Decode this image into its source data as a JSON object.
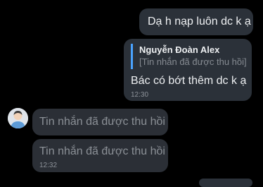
{
  "messages": {
    "outgoing_1": {
      "text": "Dạ h nạp luôn dc k ạ"
    },
    "outgoing_2": {
      "reply_name": "Nguyễn Đoàn Alex",
      "reply_text": "[Tin nhắn đã được thu hồi]",
      "text": "Bác có bớt thêm dc k ạ",
      "time": "12:30"
    },
    "incoming_1": {
      "text": "Tin nhắn đã được thu hồi"
    },
    "incoming_2": {
      "text": "Tin nhắn đã được thu hồi",
      "time": "12:32"
    }
  },
  "colors": {
    "background": "#000000",
    "bubble": "#2b2f36",
    "reply_accent": "#4aa3ff",
    "recalled_text": "#8b9096"
  },
  "icons": {
    "avatar": "user-avatar"
  }
}
